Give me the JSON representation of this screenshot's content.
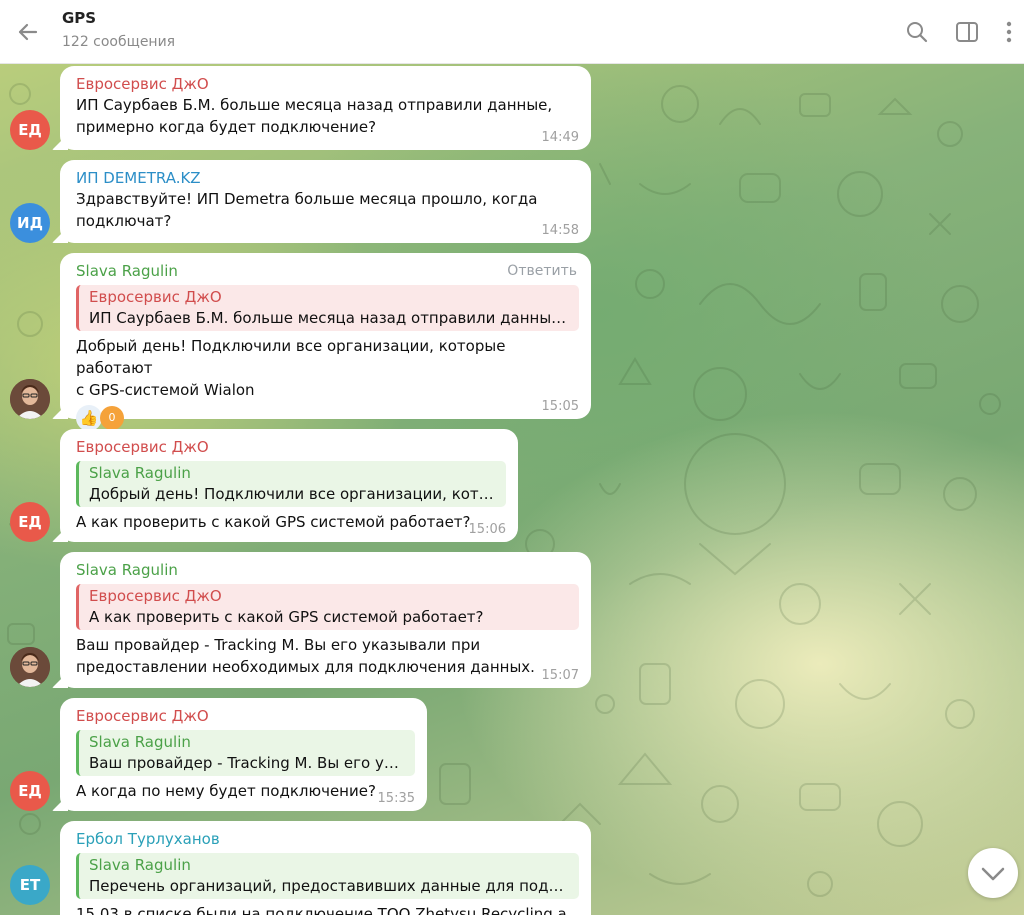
{
  "header": {
    "title": "GPS",
    "subtitle": "122 сообщения",
    "icons": [
      "back-arrow-icon",
      "search-icon",
      "sidebar-toggle-icon",
      "more-vertical-icon"
    ]
  },
  "colors": {
    "red_name": "#d14d4d",
    "green_name": "#4ba148",
    "blue_name": "#2b8ec7",
    "teal_name": "#2aa0b8",
    "avatar_red": "#e9594a",
    "avatar_blue": "#3b8fdd",
    "avatar_teal": "#3aa8c8"
  },
  "messages": [
    {
      "sender": "Евросервис ДжО",
      "lines": [
        "ИП Саурбаев Б.М. больше месяца назад отправили данные,",
        "примерно когда будет подключение?"
      ],
      "time": "14:49",
      "avatar": "ЕД"
    },
    {
      "sender": "ИП DEMETRA.KZ",
      "lines": [
        "Здравствуйте! ИП Demetra больше месяца прошло, когда",
        "подключат?"
      ],
      "time": "14:58",
      "avatar": "ИД"
    },
    {
      "sender": "Slava Ragulin",
      "reply_label": "Ответить",
      "quote_name": "Евросервис ДжО",
      "quote_text": "ИП Саурбаев Б.М. больше месяца назад отправили данные, ...",
      "lines": [
        "Добрый день! Подключили все организации, которые работают",
        "с GPS-системой Wialon"
      ],
      "reaction": "👍",
      "reaction_count": "0",
      "time": "15:05"
    },
    {
      "sender": "Евросервис ДжО",
      "quote_name": "Slava Ragulin",
      "quote_text": "Добрый день! Подключили все организации, котор...",
      "lines": [
        "А как проверить с какой GPS системой работает?"
      ],
      "time": "15:06",
      "avatar": "ЕД"
    },
    {
      "sender": "Slava Ragulin",
      "quote_name": "Евросервис ДжО",
      "quote_text": "А как проверить с какой GPS системой работает?",
      "lines": [
        "Ваш провайдер - Tracking M. Вы его указывали при",
        "предоставлении необходимых для подключения данных."
      ],
      "time": "15:07"
    },
    {
      "sender": "Евросервис ДжО",
      "quote_name": "Slava Ragulin",
      "quote_text": "Ваш провайдер - Tracking M. Вы его ука...",
      "lines": [
        "А когда по нему будет подключение?"
      ],
      "time": "15:35",
      "avatar": "ЕД"
    },
    {
      "sender": "Ербол Турлуханов",
      "quote_name": "Slava Ragulin",
      "quote_text": "Перечень организаций, предоставивших данные для подкл...",
      "lines": [
        "15.03 в списке были на подключение ТОО Zhetysu Recycling а"
      ],
      "avatar": "ЕТ"
    }
  ]
}
